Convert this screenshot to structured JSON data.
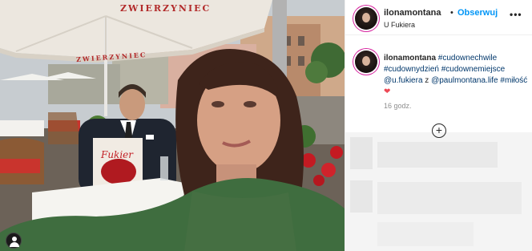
{
  "post": {
    "username": "ilonamontana",
    "separator": "•",
    "follow_label": "Obserwuj",
    "location": "U Fukiera",
    "more_icon": "•••",
    "caption": {
      "username": "ilonamontana",
      "tags": [
        "#cudownechwile",
        "#cudownydzień",
        "#cudownemiejsce"
      ],
      "text_mention_prefix": "@u.fukiera",
      "connector": "z",
      "mention": "@paulmontana.life",
      "last_tag": "#miłość",
      "heart": "❤"
    },
    "time": "16 godz.",
    "load_more_icon": "+"
  },
  "photo": {
    "umbrella_text_left": "ZWIERZYNIEC",
    "umbrella_text_mid": "ZWIERZYNIEC",
    "menu_text": "Fukier"
  },
  "colors": {
    "follow": "#0095f6",
    "heart": "#ed4956",
    "tag": "#00376b"
  }
}
